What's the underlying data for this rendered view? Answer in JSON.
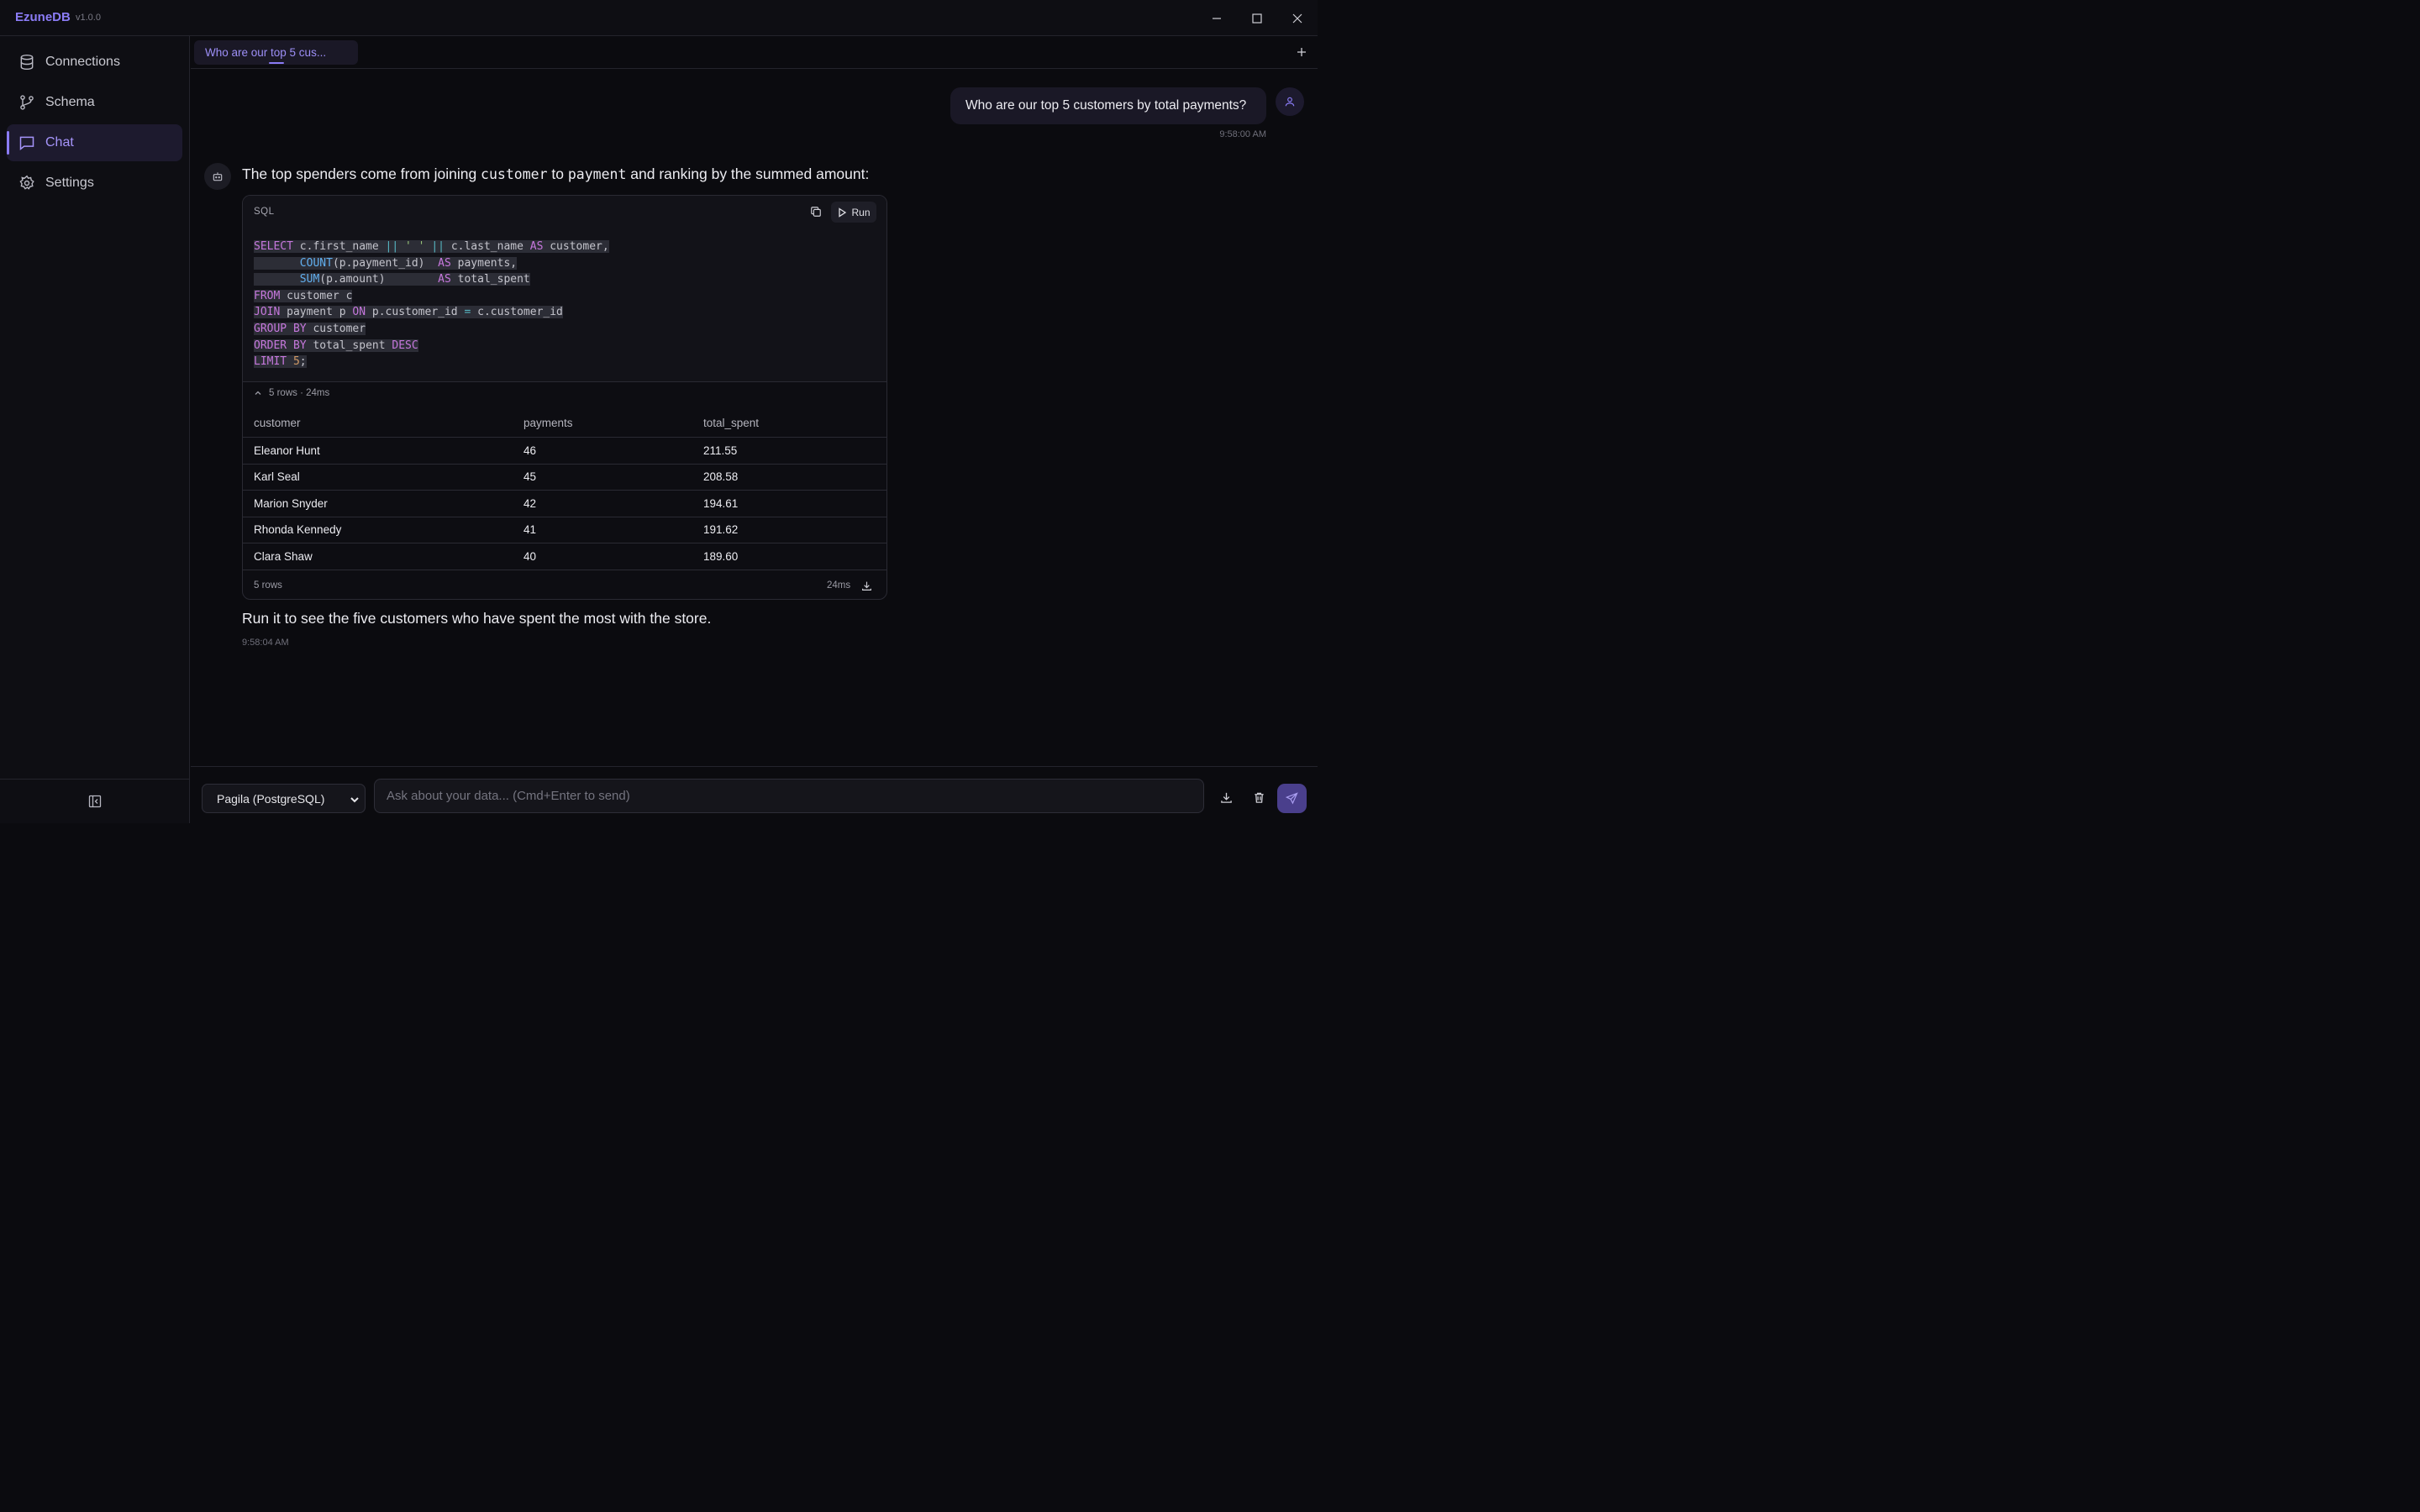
{
  "app": {
    "name": "EzuneDB",
    "version": "v1.0.0"
  },
  "sidebar": {
    "items": [
      {
        "label": "Connections",
        "icon": "database-icon",
        "active": false
      },
      {
        "label": "Schema",
        "icon": "git-branch-icon",
        "active": false
      },
      {
        "label": "Chat",
        "icon": "chat-icon",
        "active": true
      },
      {
        "label": "Settings",
        "icon": "gear-icon",
        "active": false
      }
    ]
  },
  "tabs": [
    {
      "label": "Who are our top 5 cus..."
    }
  ],
  "chat": {
    "user_message": {
      "text": "Who are our top 5 customers by total payments?",
      "time": "9:58:00 AM"
    },
    "assistant": {
      "intro_prefix": "The top spenders come from joining ",
      "intro_code1": "customer",
      "intro_middle": " to ",
      "intro_code2": "payment",
      "intro_suffix": " and ranking by the summed amount:",
      "code_lang": "SQL",
      "run_label": "Run",
      "result_meta": "5 rows · 24ms",
      "columns": [
        "customer",
        "payments",
        "total_spent"
      ],
      "rows": [
        [
          "Eleanor Hunt",
          "46",
          "211.55"
        ],
        [
          "Karl Seal",
          "45",
          "208.58"
        ],
        [
          "Marion Snyder",
          "42",
          "194.61"
        ],
        [
          "Rhonda Kennedy",
          "41",
          "191.62"
        ],
        [
          "Clara Shaw",
          "40",
          "189.60"
        ]
      ],
      "footer_rows": "5 rows",
      "footer_time": "24ms",
      "outro": "Run it to see the five customers who have spent the most with the store.",
      "time": "9:58:04 AM"
    }
  },
  "composer": {
    "connection": "Pagila (PostgreSQL)",
    "placeholder": "Ask about your data... (Cmd+Enter to send)"
  },
  "colors": {
    "accent": "#8b7cf6",
    "background": "#0b0b0f",
    "panel": "#0e0e13"
  }
}
